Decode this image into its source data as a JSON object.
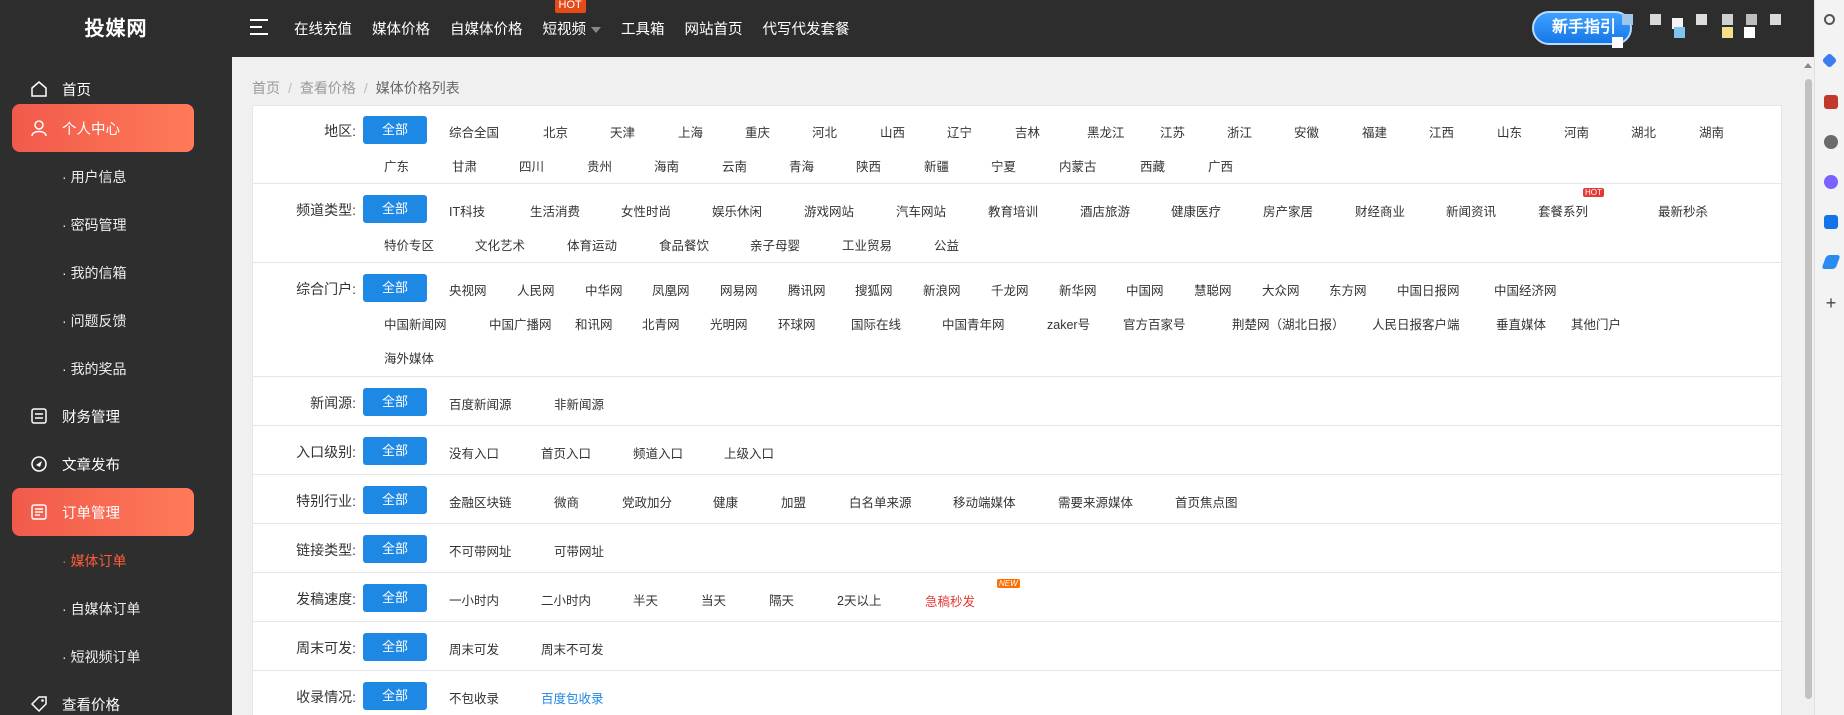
{
  "brand": {
    "logo_text": "投媒网"
  },
  "topnav": {
    "items": [
      "在线充值",
      "媒体价格",
      "自媒体价格",
      "短视频",
      "工具箱",
      "网站首页",
      "代写代发套餐"
    ],
    "hot_badge": "HOT",
    "guide_button": "新手指引"
  },
  "sidebar": {
    "home": "首页",
    "personal_center": "个人中心",
    "user_info": "用户信息",
    "password": "密码管理",
    "mailbox": "我的信箱",
    "feedback": "问题反馈",
    "rewards": "我的奖品",
    "finance": "财务管理",
    "publish": "文章发布",
    "orders": "订单管理",
    "media_orders": "媒体订单",
    "self_media_orders": "自媒体订单",
    "video_orders": "短视频订单",
    "check_price": "查看价格"
  },
  "breadcrumb": {
    "home": "首页",
    "check": "查看价格",
    "current": "媒体价格列表"
  },
  "filters": {
    "all_label": "全部",
    "region": {
      "label": "地区:",
      "options": [
        "综合全国",
        "北京",
        "天津",
        "上海",
        "重庆",
        "河北",
        "山西",
        "辽宁",
        "吉林",
        "黑龙江",
        "江苏",
        "浙江",
        "安徽",
        "福建",
        "江西",
        "山东",
        "河南",
        "湖北",
        "湖南",
        "广东",
        "甘肃",
        "四川",
        "贵州",
        "海南",
        "云南",
        "青海",
        "陕西",
        "新疆",
        "宁夏",
        "内蒙古",
        "西藏",
        "广西"
      ]
    },
    "channel": {
      "label": "频道类型:",
      "options": [
        "IT科技",
        "生活消费",
        "女性时尚",
        "娱乐休闲",
        "游戏网站",
        "汽车网站",
        "教育培训",
        "酒店旅游",
        "健康医疗",
        "房产家居",
        "财经商业",
        "新闻资讯",
        "套餐系列",
        "最新秒杀",
        "特价专区",
        "文化艺术",
        "体育运动",
        "食品餐饮",
        "亲子母婴",
        "工业贸易",
        "公益"
      ],
      "hot_badge": "HOT"
    },
    "portal": {
      "label": "综合门户:",
      "options": [
        "央视网",
        "人民网",
        "中华网",
        "凤凰网",
        "网易网",
        "腾讯网",
        "搜狐网",
        "新浪网",
        "千龙网",
        "新华网",
        "中国网",
        "慧聪网",
        "大众网",
        "东方网",
        "中国日报网",
        "中国经济网",
        "中国新闻网",
        "中国广播网",
        "和讯网",
        "北青网",
        "光明网",
        "环球网",
        "国际在线",
        "中国青年网",
        "zaker号",
        "官方百家号",
        "荆楚网（湖北日报）",
        "人民日报客户端",
        "垂直媒体",
        "其他门户",
        "海外媒体"
      ]
    },
    "news_source": {
      "label": "新闻源:",
      "options": [
        "百度新闻源",
        "非新闻源"
      ]
    },
    "entry_level": {
      "label": "入口级别:",
      "options": [
        "没有入口",
        "首页入口",
        "频道入口",
        "上级入口"
      ]
    },
    "industry": {
      "label": "特别行业:",
      "options": [
        "金融区块链",
        "微商",
        "党政加分",
        "健康",
        "加盟",
        "白名单来源",
        "移动端媒体",
        "需要来源媒体",
        "首页焦点图"
      ]
    },
    "link_type": {
      "label": "链接类型:",
      "options": [
        "不可带网址",
        "可带网址"
      ]
    },
    "speed": {
      "label": "发稿速度:",
      "options": [
        "一小时内",
        "二小时内",
        "半天",
        "当天",
        "隔天",
        "2天以上",
        "急稿秒发"
      ],
      "new_badge": "NEW"
    },
    "weekend": {
      "label": "周末可发:",
      "options": [
        "周末可发",
        "周末不可发"
      ]
    },
    "indexing": {
      "label": "收录情况:",
      "options": [
        "不包收录",
        "百度包收录"
      ]
    }
  },
  "colors": {
    "accent": "#1e88e5",
    "sidebar_active": "#f15a4a",
    "topbar": "#2d2d2d"
  }
}
